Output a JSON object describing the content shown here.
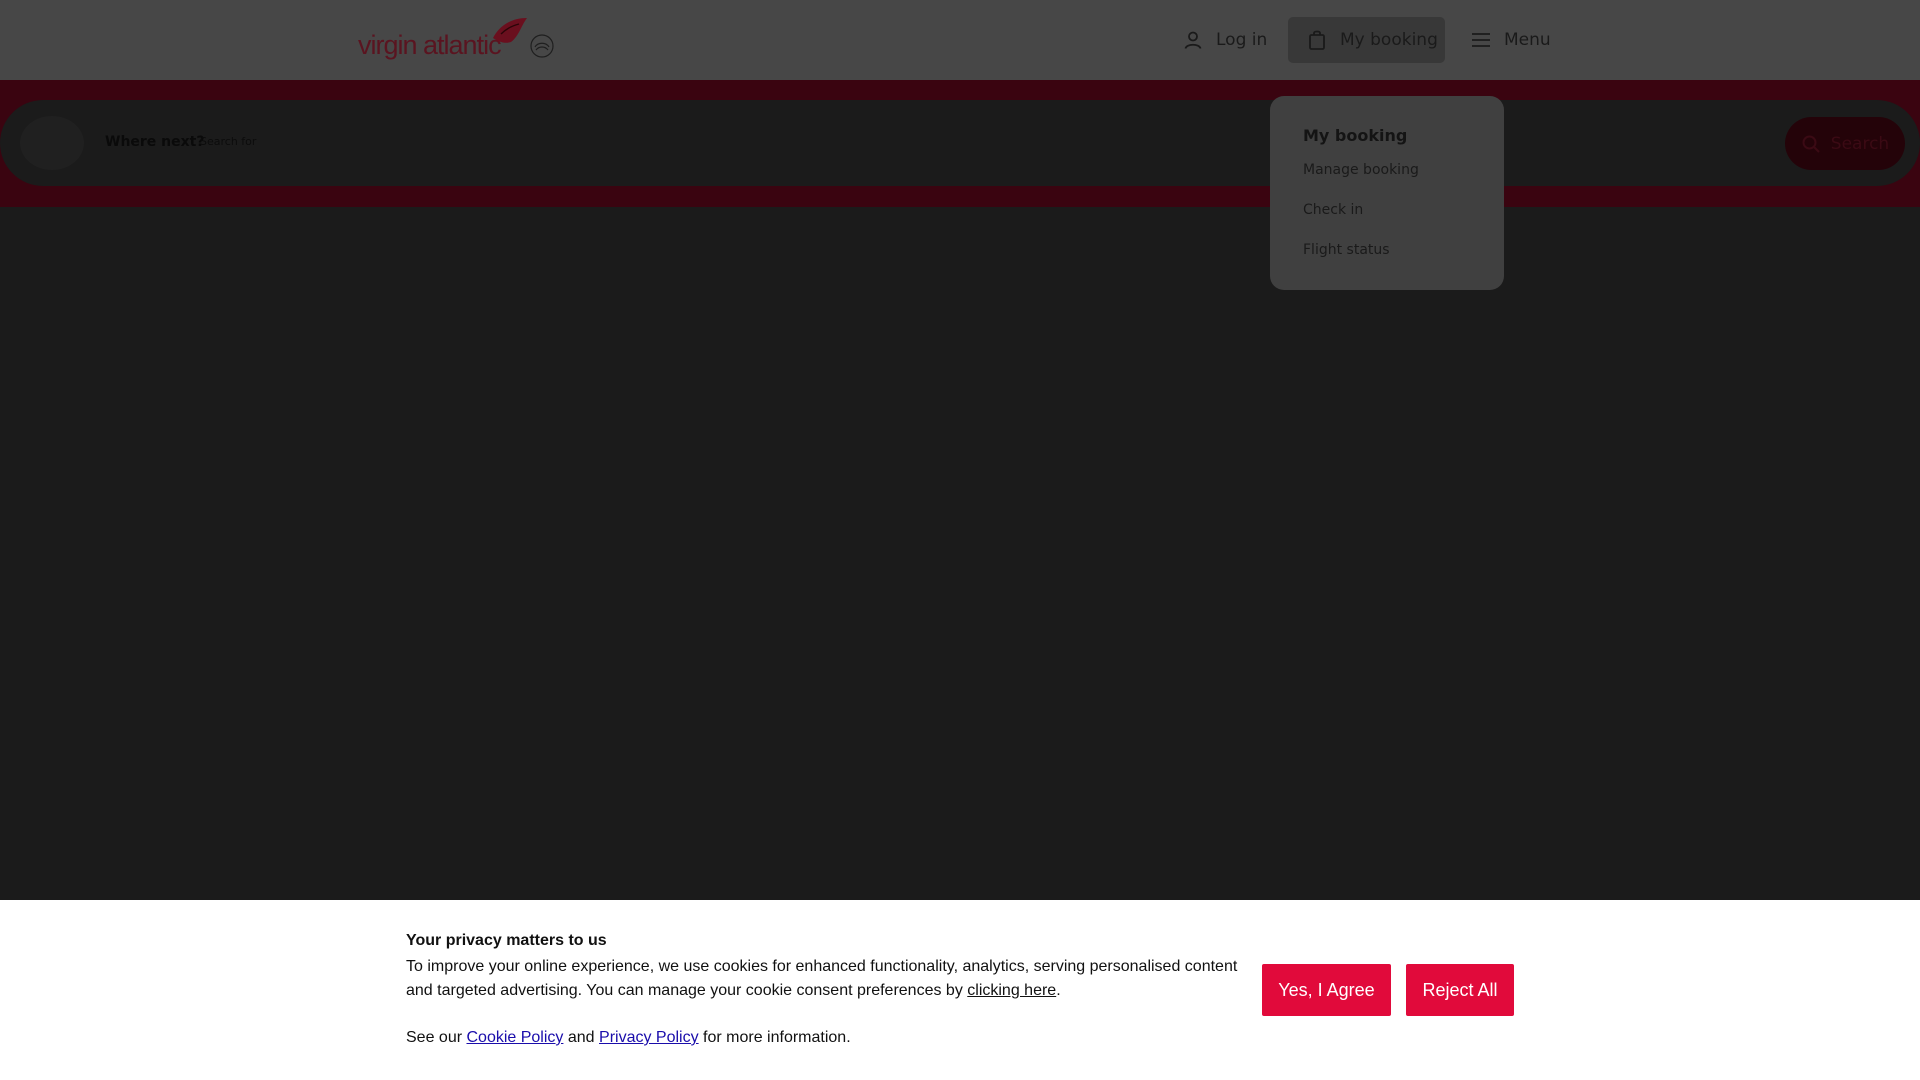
{
  "header": {
    "logo_text": "virgin atlantic",
    "nav": {
      "login": "Log in",
      "my_booking": "My booking",
      "menu": "Menu"
    }
  },
  "search": {
    "label": "Where next?",
    "placeholder": "Search for",
    "button": "Search"
  },
  "dropdown": {
    "title": "My booking",
    "items": [
      {
        "label": "Manage booking"
      },
      {
        "label": "Check in"
      },
      {
        "label": "Flight status"
      }
    ]
  },
  "cookie": {
    "title": "Your privacy matters to us",
    "text_before_link": "To improve your online experience, we use cookies for enhanced functionality, analytics, serving personalised content and targeted advertising. You can manage your cookie consent preferences by ",
    "link_clicking_here": "clicking here",
    "text_after_link": ".",
    "see_our": "See our ",
    "cookie_policy": "Cookie Policy",
    "and": " and ",
    "privacy_policy": "Privacy Policy",
    "more_info": " for more information.",
    "agree_button": "Yes, I Agree",
    "reject_button": "Reject All"
  },
  "colors": {
    "brand_red": "#e10a3b",
    "overlay_header": "#474747",
    "overlay_band": "#3a0410"
  }
}
